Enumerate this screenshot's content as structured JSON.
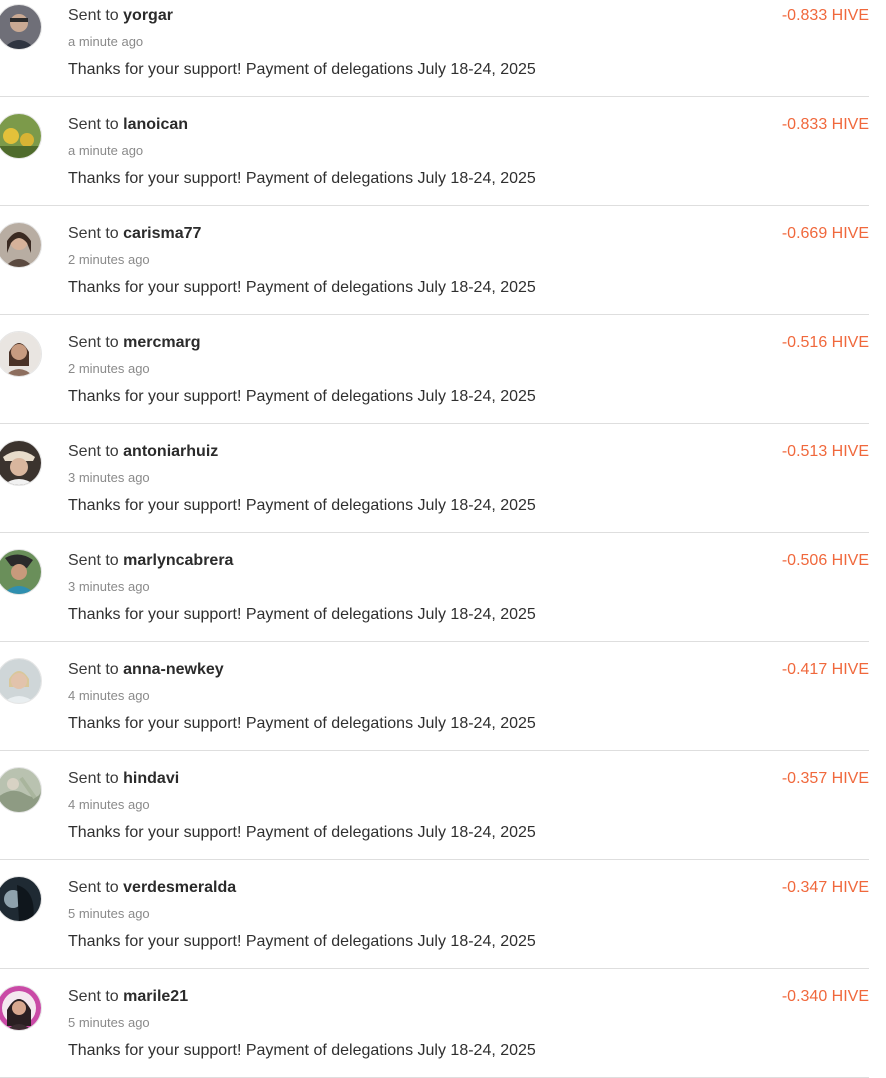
{
  "accent_color": "#f0683c",
  "transfers": [
    {
      "prefix": "Sent to",
      "user": "yorgar",
      "time": "a minute ago",
      "memo": "Thanks for your support! Payment of delegations July 18-24, 2025",
      "amount": "-0.833 HIVE",
      "avatar_icon": "user-avatar-icon"
    },
    {
      "prefix": "Sent to",
      "user": "lanoican",
      "time": "a minute ago",
      "memo": "Thanks for your support! Payment of delegations July 18-24, 2025",
      "amount": "-0.833 HIVE",
      "avatar_icon": "user-avatar-icon"
    },
    {
      "prefix": "Sent to",
      "user": "carisma77",
      "time": "2 minutes ago",
      "memo": "Thanks for your support! Payment of delegations July 18-24, 2025",
      "amount": "-0.669 HIVE",
      "avatar_icon": "user-avatar-icon"
    },
    {
      "prefix": "Sent to",
      "user": "mercmarg",
      "time": "2 minutes ago",
      "memo": "Thanks for your support! Payment of delegations July 18-24, 2025",
      "amount": "-0.516 HIVE",
      "avatar_icon": "user-avatar-icon"
    },
    {
      "prefix": "Sent to",
      "user": "antoniarhuiz",
      "time": "3 minutes ago",
      "memo": "Thanks for your support! Payment of delegations July 18-24, 2025",
      "amount": "-0.513 HIVE",
      "avatar_icon": "user-avatar-icon"
    },
    {
      "prefix": "Sent to",
      "user": "marlyncabrera",
      "time": "3 minutes ago",
      "memo": "Thanks for your support! Payment of delegations July 18-24, 2025",
      "amount": "-0.506 HIVE",
      "avatar_icon": "user-avatar-icon"
    },
    {
      "prefix": "Sent to",
      "user": "anna-newkey",
      "time": "4 minutes ago",
      "memo": "Thanks for your support! Payment of delegations July 18-24, 2025",
      "amount": "-0.417 HIVE",
      "avatar_icon": "user-avatar-icon"
    },
    {
      "prefix": "Sent to",
      "user": "hindavi",
      "time": "4 minutes ago",
      "memo": "Thanks for your support! Payment of delegations July 18-24, 2025",
      "amount": "-0.357 HIVE",
      "avatar_icon": "user-avatar-icon"
    },
    {
      "prefix": "Sent to",
      "user": "verdesmeralda",
      "time": "5 minutes ago",
      "memo": "Thanks for your support! Payment of delegations July 18-24, 2025",
      "amount": "-0.347 HIVE",
      "avatar_icon": "user-avatar-icon"
    },
    {
      "prefix": "Sent to",
      "user": "marile21",
      "time": "5 minutes ago",
      "memo": "Thanks for your support! Payment of delegations July 18-24, 2025",
      "amount": "-0.340 HIVE",
      "avatar_icon": "user-avatar-icon"
    }
  ]
}
